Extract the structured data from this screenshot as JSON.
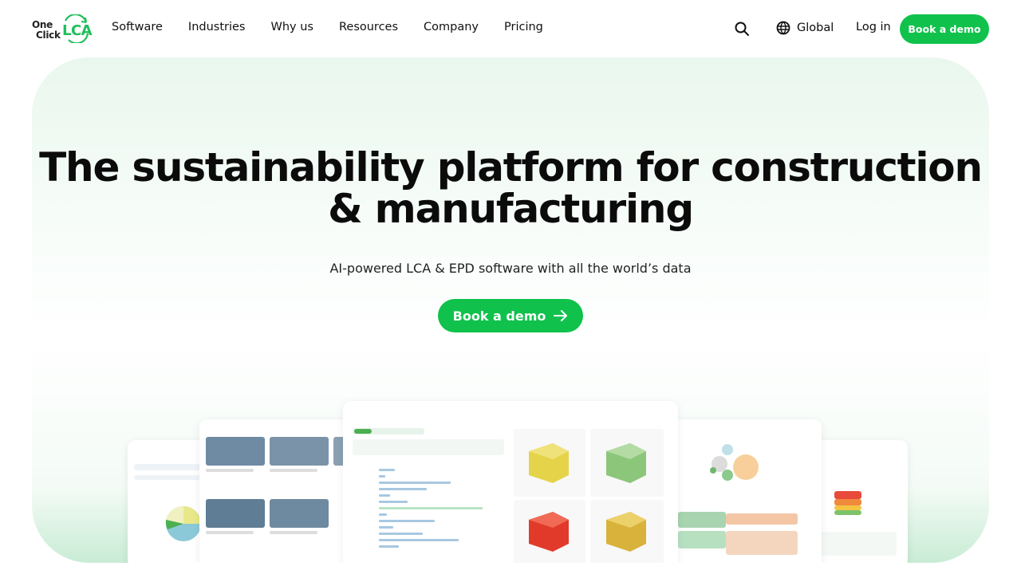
{
  "nav": {
    "logo": {
      "line1": "One",
      "line2": "Click",
      "mark": "LCA"
    },
    "items": [
      "Software",
      "Industries",
      "Why us",
      "Resources",
      "Company",
      "Pricing"
    ],
    "search_icon": "search-icon",
    "region_icon": "globe-icon",
    "region_label": "Global",
    "login_label": "Log in",
    "cta_label": "Book a demo"
  },
  "hero": {
    "title_line1": "The sustainability platform for construction",
    "title_line2": "& manufacturing",
    "subtitle": "AI-powered LCA & EPD software with all the world’s data",
    "cta_label": "Book a demo",
    "cta_icon": "arrow-right-icon"
  },
  "colors": {
    "brand": "#10c24c",
    "hero_bg": "#e9f7ee"
  }
}
